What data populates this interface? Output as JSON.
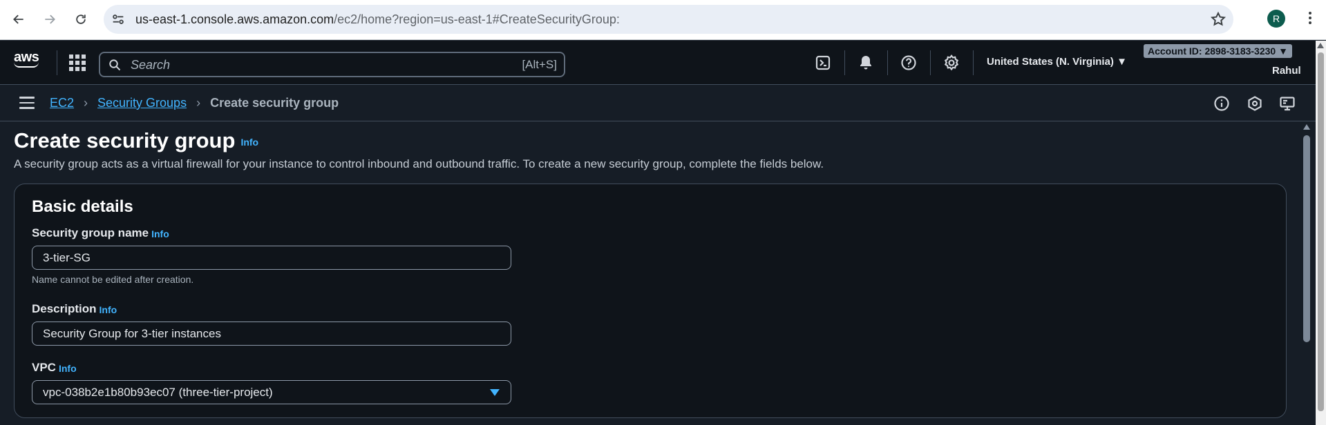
{
  "browser": {
    "url_host": "us-east-1.console.aws.amazon.com",
    "url_path": "/ec2/home?region=us-east-1#CreateSecurityGroup:",
    "profile_initial": "R"
  },
  "topnav": {
    "logo_text": "aws",
    "search_placeholder": "Search",
    "search_shortcut": "[Alt+S]",
    "region": "United States (N. Virginia) ▼",
    "account_id": "Account ID: 2898-3183-3230 ▼",
    "user": "Rahul"
  },
  "breadcrumb": {
    "items": [
      "EC2",
      "Security Groups"
    ],
    "current": "Create security group"
  },
  "page": {
    "title": "Create security group",
    "info_label": "Info",
    "description": "A security group acts as a virtual firewall for your instance to control inbound and outbound traffic. To create a new security group, complete the fields below."
  },
  "basic_details": {
    "title": "Basic details",
    "name_label": "Security group name",
    "name_value": "3-tier-SG",
    "name_hint": "Name cannot be edited after creation.",
    "description_label": "Description",
    "description_value": "Security Group for 3-tier instances",
    "vpc_label": "VPC",
    "vpc_value": "vpc-038b2e1b80b93ec07 (three-tier-project)",
    "info_label": "Info"
  },
  "colors": {
    "link": "#42b4ff",
    "background": "#161d26",
    "panel": "#0f141a"
  }
}
